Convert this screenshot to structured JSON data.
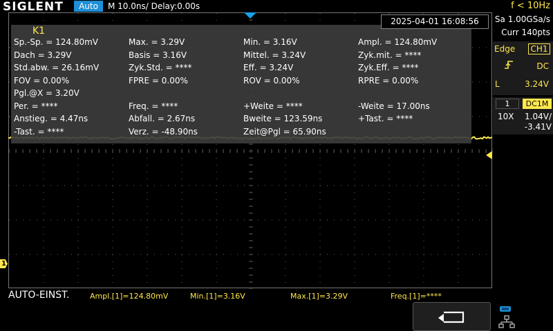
{
  "topbar": {
    "brand": "SIGLENT",
    "run_mode": "Auto",
    "timebase": "M 10.0ns/  Delay:0.00s",
    "trigger_freq": "f < 10Hz",
    "datetime": "2025-04-01 16:08:56"
  },
  "acquisition": {
    "sample_rate": "Sa 1.00GSa/s",
    "curr_points": "Curr 140pts"
  },
  "trigger": {
    "type": "Edge",
    "source": "CH1",
    "coupling": "DC",
    "level_label": "L",
    "level": "3.24V"
  },
  "channel": {
    "number": "1",
    "coupling": "DC1M",
    "probe": "10X",
    "volts_per_div": "1.04V/",
    "offset": "-3.41V",
    "marker": "1"
  },
  "measurements": {
    "title": "K1",
    "rows": [
      [
        "Sp.-Sp. = 124.80mV",
        "Max. = 3.29V",
        "Min. = 3.16V",
        "Ampl. = 124.80mV"
      ],
      [
        "Dach = 3.29V",
        "Basis = 3.16V",
        "Mittel. = 3.24V",
        "Zyk.mit. = ****"
      ],
      [
        "Std.abw. = 26.16mV",
        "Zyk.Std. = ****",
        "Eff. = 3.24V",
        "Zyk.Eff. = ****"
      ],
      [
        "FOV = 0.00%",
        "FPRE = 0.00%",
        "ROV = 0.00%",
        "RPRE = 0.00%"
      ],
      [
        "Pgl.@X = 3.20V",
        "",
        "",
        ""
      ],
      [
        "Per. = ****",
        "Freq. = ****",
        "+Weite = ****",
        "-Weite = 17.00ns"
      ],
      [
        "Anstieg. = 4.47ns",
        "Abfall. = 2.67ns",
        "Bweite = 123.59ns",
        "+Tast. = ****"
      ],
      [
        "-Tast. = ****",
        "Verz. = -48.90ns",
        "Zeit@Pgl = 65.90ns",
        ""
      ]
    ]
  },
  "bottom": {
    "autoset": "AUTO-EINST.",
    "items": [
      "Ampl.[1]=124.80mV",
      "Min.[1]=3.16V",
      "Max.[1]=3.29V",
      "Freq.[1]=****"
    ]
  },
  "icons": {
    "back": "return-arrow-icon",
    "network": "network-icon"
  },
  "colors": {
    "channel1": "#ffe84d",
    "accent": "#1e8fd6"
  }
}
